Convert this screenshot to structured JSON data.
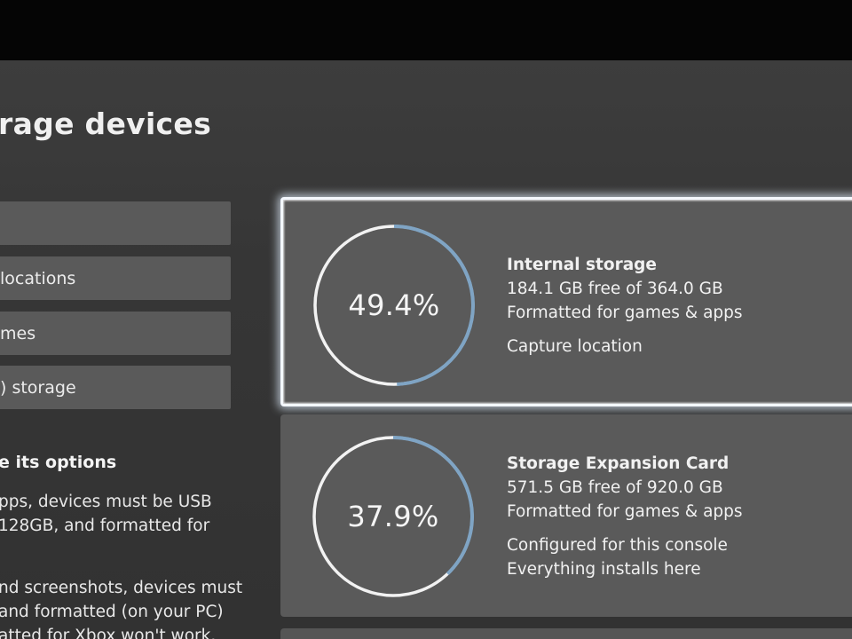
{
  "page": {
    "title": "rage devices"
  },
  "menu": {
    "items": [
      {
        "label": ""
      },
      {
        "label": "locations"
      },
      {
        "label": "mes"
      },
      {
        "label": ") storage"
      }
    ]
  },
  "info": {
    "heading": "e its options",
    "para1": [
      "pps, devices must be USB",
      "128GB, and formatted for"
    ],
    "para2": [
      "nd screenshots, devices must",
      "and formatted (on your PC)",
      "atted for Xbox won't work."
    ]
  },
  "devices": [
    {
      "percent_label": "49.4%",
      "percent_used": 49.4,
      "name": "Internal storage",
      "free": "184.1 GB free of 364.0 GB",
      "format": "Formatted for games & apps",
      "note1": "Capture location",
      "note2": ""
    },
    {
      "percent_label": "37.9%",
      "percent_used": 37.9,
      "name": "Storage Expansion Card",
      "free": "571.5 GB free of 920.0 GB",
      "format": "Formatted for games & apps",
      "note1": "Configured for this console",
      "note2": "Everything installs here"
    }
  ],
  "colors": {
    "background": "#363636",
    "card": "#5a5a5a",
    "ring_track": "#f2f2f2",
    "ring_fill": "#7fa4c4",
    "focus_outline": "#f4f8ff"
  },
  "icons": {
    "cursor": "selection-cursor-icon"
  }
}
